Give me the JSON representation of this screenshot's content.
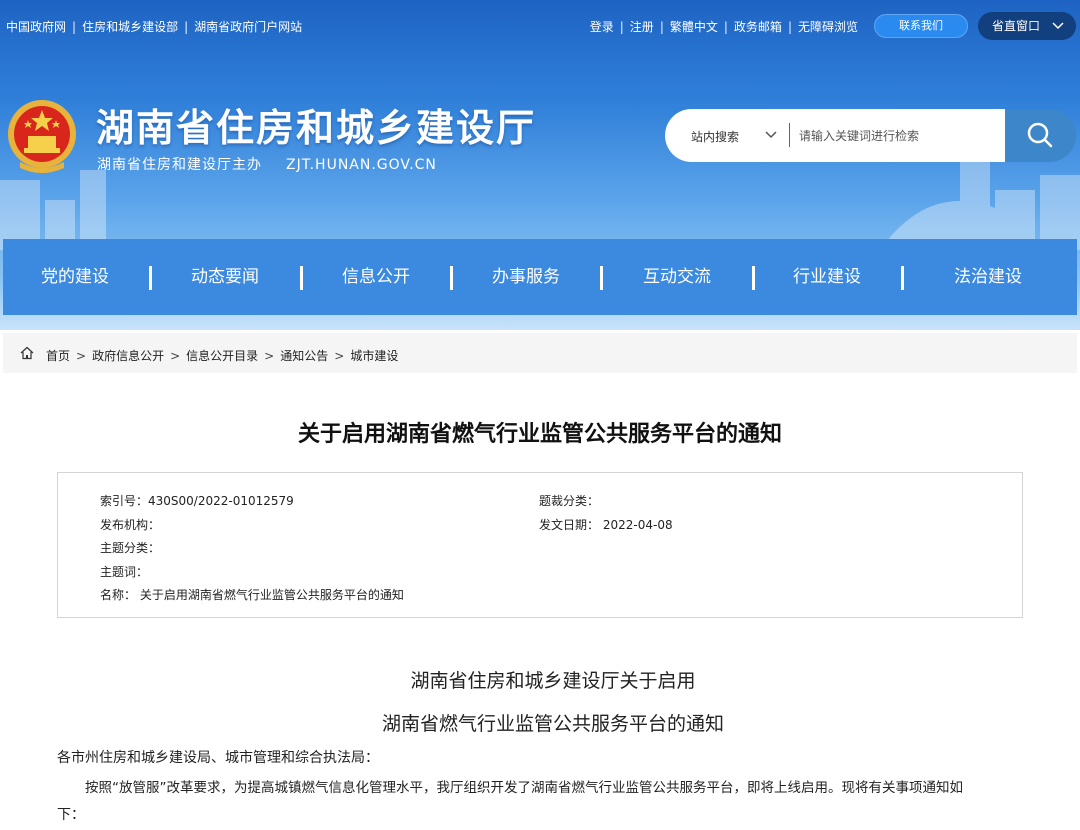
{
  "topbar": {
    "left_links": [
      "中国政府网",
      "住房和城乡建设部",
      "湖南省政府门户网站"
    ],
    "right_links": [
      "登录",
      "注册",
      "繁體中文",
      "政务邮箱",
      "无障碍浏览"
    ],
    "contact_label": "联系我们",
    "province_label": "省直窗口"
  },
  "site": {
    "title": "湖南省住房和城乡建设厅",
    "sponsor": "湖南省住房和建设厅主办",
    "domain": "ZJT.HUNAN.GOV.CN"
  },
  "search": {
    "scope": "站内搜索",
    "placeholder": "请输入关键词进行检索"
  },
  "nav": [
    "党的建设",
    "动态要闻",
    "信息公开",
    "办事服务",
    "互动交流",
    "行业建设",
    "法治建设"
  ],
  "breadcrumb": [
    "首页",
    "政府信息公开",
    "信息公开目录",
    "通知公告",
    "城市建设"
  ],
  "article": {
    "title": "关于启用湖南省燃气行业监管公共服务平台的通知",
    "meta": {
      "index_label": "索引号：",
      "index_value": "430S00/2022-01012579",
      "publisher_label": "发布机构：",
      "subject_label": "主题分类：",
      "keywords_label": "主题词：",
      "name_label": "名称：",
      "name_value": "关于启用湖南省燃气行业监管公共服务平台的通知",
      "genre_label": "题裁分类：",
      "date_label": "发文日期：",
      "date_value": "2022-04-08"
    },
    "heading_line1": "湖南省住房和城乡建设厅关于启用",
    "heading_line2": "湖南省燃气行业监管公共服务平台的通知",
    "salutation": "各市州住房和城乡建设局、城市管理和综合执法局：",
    "para1_line1": "按照“放管服”改革要求，为提高城镇燃气信息化管理水平，我厅组织开发了湖南省燃气行业监管公共服务平台，即将上线启用。现将有关事项通知如",
    "para1_line2": "下："
  },
  "colors": {
    "nav_bg": "#3b8ae0",
    "province_btn": "#123f7e",
    "contact_btn": "#2a8af0",
    "search_btn": "#3c86c9"
  },
  "icons": [
    "home-icon",
    "search-icon",
    "chevron-down-icon",
    "national-emblem"
  ]
}
